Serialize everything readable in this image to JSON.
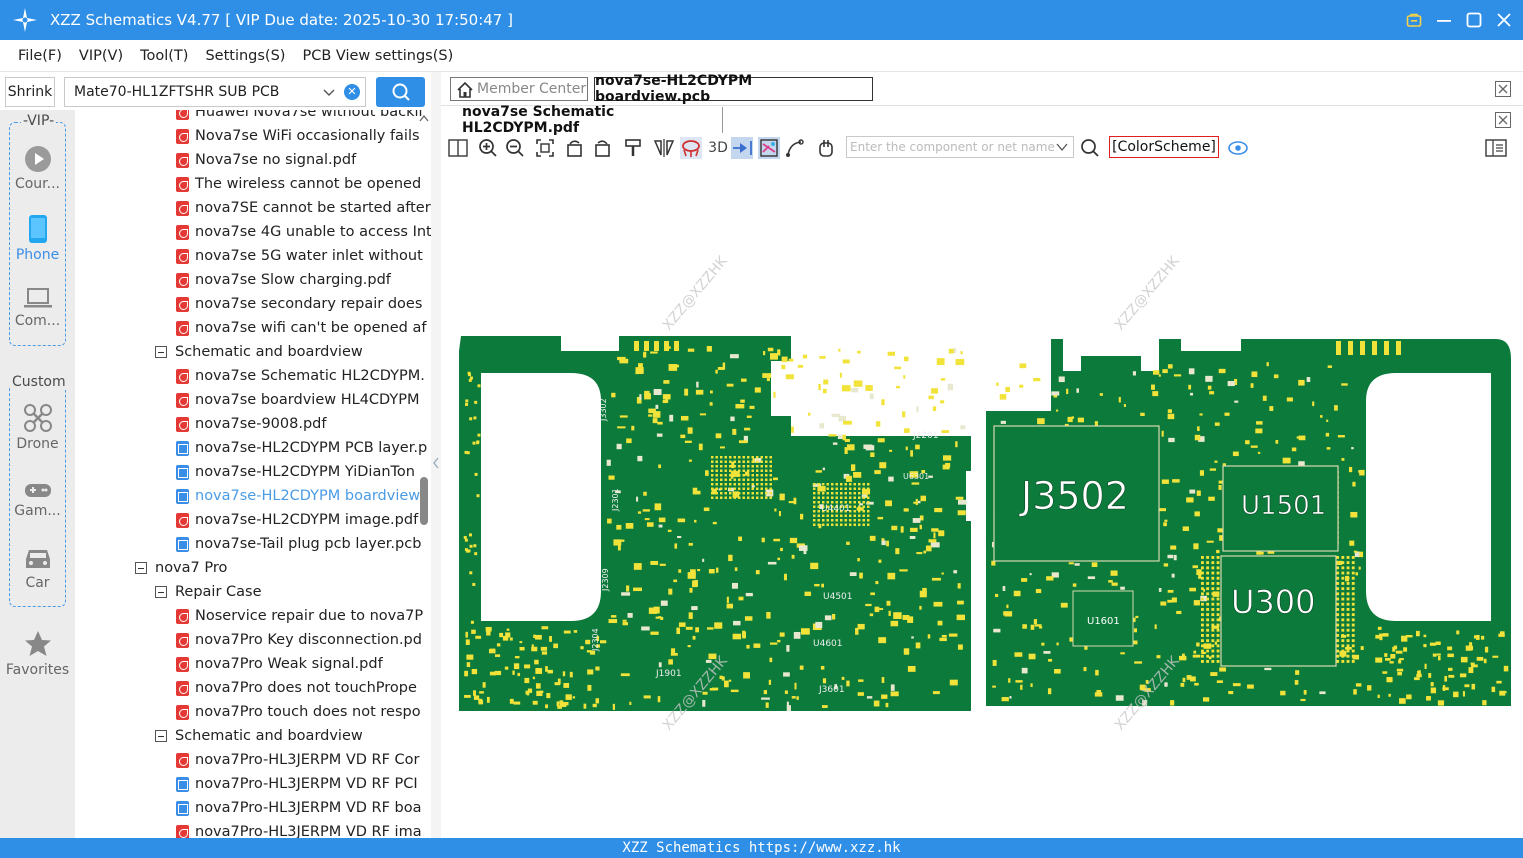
{
  "window": {
    "title": "XZZ Schematics V4.77 [ VIP Due date: 2025-10-30 17:50:47 ]"
  },
  "menu": [
    "File(F)",
    "VIP(V)",
    "Tool(T)",
    "Settings(S)",
    "PCB View settings(S)"
  ],
  "left_toolbar": {
    "shrink_label": "Shrink",
    "combo_value": "Mate70-HL1ZFTSHR SUB PCB"
  },
  "sidebar": {
    "vip_label": "-VIP-",
    "vip_items": [
      {
        "label": "Cour...",
        "icon": "play-icon"
      },
      {
        "label": "Phone",
        "icon": "phone-icon"
      },
      {
        "label": "Com...",
        "icon": "laptop-icon"
      }
    ],
    "custom_label": "Custom",
    "custom_items": [
      {
        "label": "Drone",
        "icon": "drone-icon"
      },
      {
        "label": "Gam...",
        "icon": "gamepad-icon"
      },
      {
        "label": "Car",
        "icon": "car-icon"
      }
    ],
    "favorites_label": "Favorites"
  },
  "tree": [
    {
      "type": "pdf",
      "level": 2,
      "text": "Huawei Nova7se without backli"
    },
    {
      "type": "pdf",
      "level": 2,
      "text": "Nova7se WiFi occasionally fails"
    },
    {
      "type": "pdf",
      "level": 2,
      "text": "Nova7se no signal.pdf"
    },
    {
      "type": "pdf",
      "level": 2,
      "text": "The wireless cannot be opened"
    },
    {
      "type": "pdf",
      "level": 2,
      "text": "nova7SE cannot be started after"
    },
    {
      "type": "pdf",
      "level": 2,
      "text": "nova7se 4G unable to access Int"
    },
    {
      "type": "pdf",
      "level": 2,
      "text": "nova7se 5G water inlet without"
    },
    {
      "type": "pdf",
      "level": 2,
      "text": "nova7se Slow charging.pdf"
    },
    {
      "type": "pdf",
      "level": 2,
      "text": "nova7se secondary repair does"
    },
    {
      "type": "pdf",
      "level": 2,
      "text": "nova7se wifi can't be opened af"
    },
    {
      "type": "folder",
      "level": 1,
      "text": "Schematic and boardview"
    },
    {
      "type": "pdf",
      "level": 2,
      "text": "nova7se Schematic HL2CDYPM."
    },
    {
      "type": "pdf",
      "level": 2,
      "text": "nova7se boardview HL4CDYPM"
    },
    {
      "type": "pdf",
      "level": 2,
      "text": "nova7se-9008.pdf"
    },
    {
      "type": "pcb",
      "level": 2,
      "text": "nova7se-HL2CDYPM PCB layer.p"
    },
    {
      "type": "pcb",
      "level": 2,
      "text": "nova7se-HL2CDYPM YiDianTon"
    },
    {
      "type": "pcb",
      "level": 2,
      "text": "nova7se-HL2CDYPM boardview",
      "selected": true
    },
    {
      "type": "pdf",
      "level": 2,
      "text": "nova7se-HL2CDYPM image.pdf"
    },
    {
      "type": "pcb",
      "level": 2,
      "text": "nova7se-Tail plug pcb layer.pcb"
    },
    {
      "type": "folder",
      "level": 0,
      "text": "nova7 Pro"
    },
    {
      "type": "folder",
      "level": 1,
      "text": "Repair Case"
    },
    {
      "type": "pdf",
      "level": 2,
      "text": "Noservice repair due to nova7P"
    },
    {
      "type": "pdf",
      "level": 2,
      "text": "nova7Pro Key disconnection.pd"
    },
    {
      "type": "pdf",
      "level": 2,
      "text": "nova7Pro Weak signal.pdf"
    },
    {
      "type": "pdf",
      "level": 2,
      "text": "nova7Pro does not touchPrope"
    },
    {
      "type": "pdf",
      "level": 2,
      "text": "nova7Pro touch does not respo"
    },
    {
      "type": "folder",
      "level": 1,
      "text": "Schematic and boardview"
    },
    {
      "type": "pdf",
      "level": 2,
      "text": "nova7Pro-HL3JERPM VD RF Cor"
    },
    {
      "type": "pcb",
      "level": 2,
      "text": "nova7Pro-HL3JERPM VD RF PCI"
    },
    {
      "type": "pcb",
      "level": 2,
      "text": "nova7Pro-HL3JERPM VD RF boa"
    },
    {
      "type": "pdf",
      "level": 2,
      "text": "nova7Pro-HL3JERPM VD RF ima"
    }
  ],
  "tabs": {
    "member_center": "Member Center",
    "pcb_tab": "nova7se-HL2CDYPM boardview.pcb",
    "schematic_tab": "nova7se Schematic HL2CDYPM.pdf"
  },
  "toolbar": {
    "label_3d": "3D",
    "search_placeholder": "Enter the component or net name",
    "color_scheme": "[ColorScheme]"
  },
  "board": {
    "watermark": "XZZ@XZZHK",
    "labels": [
      "J3502",
      "U1501",
      "U300",
      "U1601",
      "J2201",
      "J1901",
      "J3601",
      "U4501",
      "U4601",
      "U4401",
      "J3302",
      "J2301",
      "J2309",
      "J2304",
      "U6301"
    ]
  },
  "status": {
    "text": "XZZ Schematics https://www.xzz.hk"
  },
  "colors": {
    "accent": "#2f8fe6",
    "pcb_green": "#0b7a3b",
    "pad_yellow": "#f2e33a"
  }
}
